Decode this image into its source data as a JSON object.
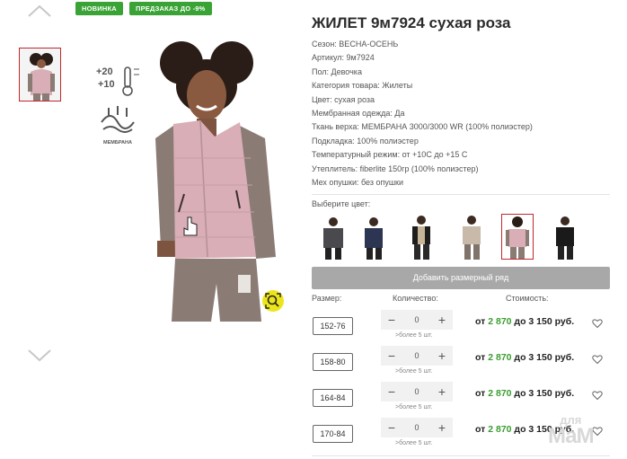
{
  "badges": {
    "new": "НОВИНКА",
    "preorder": "ПРЕДЗАКАЗ ДО -9%"
  },
  "product": {
    "title": "ЖИЛЕТ 9м7924 сухая роза",
    "properties": [
      "Сезон: ВЕСНА-ОСЕНЬ",
      "Артикул: 9м7924",
      "Пол: Девочка",
      "Категория товара: Жилеты",
      "Цвет: сухая роза",
      "Мембранная одежда: Да",
      "Ткань верха: МЕМБРАНА 3000/3000 WR (100% полиэстер)",
      "Подкладка: 100% полиэстер",
      "Температурный режим: от +10С до +15 С",
      "Утеплитель: fiberlite 150гр (100% полиэстер)",
      "Мех опушки: без опушки"
    ]
  },
  "image_icons": {
    "temp_high": "+20",
    "temp_low": "+10",
    "membrane_label": "МЕМБРАНА"
  },
  "color_select": {
    "label": "Выберите цвет:",
    "swatches": [
      {
        "name": "grey-black"
      },
      {
        "name": "navy"
      },
      {
        "name": "black-beige"
      },
      {
        "name": "beige-grey"
      },
      {
        "name": "dry-rose",
        "selected": true
      },
      {
        "name": "black"
      }
    ]
  },
  "add_size_button": "Добавить размерный ряд",
  "headers": {
    "size": "Размер:",
    "qty": "Количество:",
    "cost": "Стоимость:"
  },
  "rows": [
    {
      "size": "152-76",
      "qty": "0",
      "stock": ">более 5 шт.",
      "price_from_prefix": "от ",
      "price_from": "2 870",
      "price_to": " до 3 150 руб."
    },
    {
      "size": "158-80",
      "qty": "0",
      "stock": ">более 5 шт.",
      "price_from_prefix": "от ",
      "price_from": "2 870",
      "price_to": " до 3 150 руб."
    },
    {
      "size": "164-84",
      "qty": "0",
      "stock": ">более 5 шт.",
      "price_from_prefix": "от ",
      "price_from": "2 870",
      "price_to": " до 3 150 руб."
    },
    {
      "size": "170-84",
      "qty": "0",
      "stock": ">более 5 шт.",
      "price_from_prefix": "от ",
      "price_from": "2 870",
      "price_to": " до 3 150 руб."
    }
  ],
  "qty_controls": {
    "minus": "−",
    "plus": "+"
  },
  "watermark": {
    "top": "для",
    "bottom": "МаМ"
  },
  "colors": {
    "accent_green": "#3aa335",
    "price_green": "#3a9d2e",
    "selected_border": "#c0282d",
    "button_grey": "#a8a8a8",
    "zoom_yellow": "#ece51c",
    "vest_pink": "#d9aeb6"
  }
}
